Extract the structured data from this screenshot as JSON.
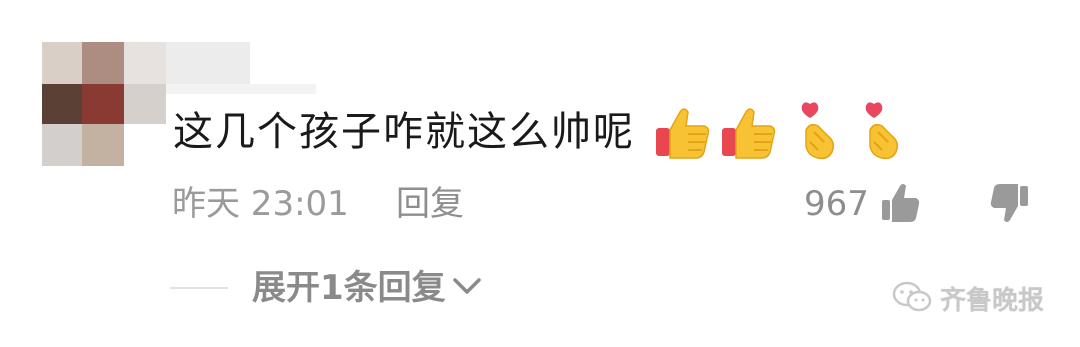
{
  "comment": {
    "text": "这几个孩子咋就这么帅呢",
    "emojis": [
      "thumbs-up-icon",
      "thumbs-up-icon",
      "finger-heart-icon",
      "finger-heart-icon"
    ],
    "time": "昨天 23:01",
    "reply_label": "回复",
    "like_count": "967",
    "like_icon": "thumb-up-icon",
    "dislike_icon": "thumb-down-icon"
  },
  "replies": {
    "expand_label": "展开1条回复",
    "chevron_icon": "chevron-down-icon"
  },
  "watermark": {
    "text": "齐鲁晚报",
    "icon": "wechat-icon"
  },
  "colors": {
    "text": "#1a1a1a",
    "meta": "#9a9a9a",
    "watermark": "#c8c8c8"
  }
}
